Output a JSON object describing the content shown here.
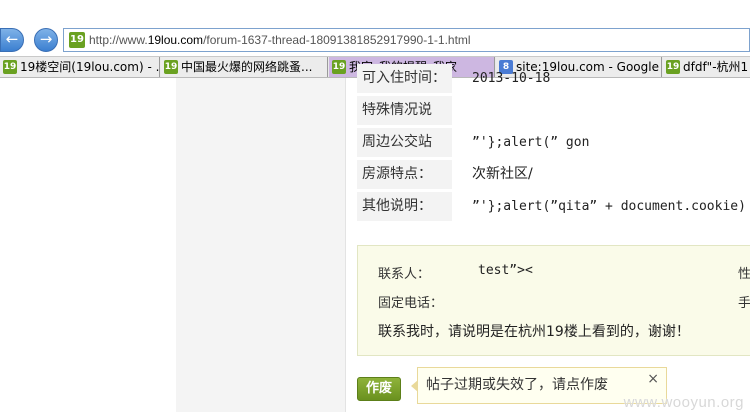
{
  "browser": {
    "back_glyph": "←",
    "forward_glyph": "→",
    "site_icon": "19",
    "url_prefix": "http://www.",
    "url_host": "19lou.com",
    "url_path": "/forum-1637-thread-18091381852917990-1-1.html",
    "favorites": [
      {
        "label": "19楼空间(19lou.com) - ...",
        "icon": "19",
        "icon_type": "19lou"
      },
      {
        "label": "中国最火爆的网络跳蚤...",
        "icon": "19",
        "icon_type": "19lou"
      },
      {
        "label": "我家_我的提醒_我家",
        "icon": "19",
        "icon_type": "19lou"
      },
      {
        "label": "site:19lou.com - Google ...",
        "icon": "8",
        "icon_type": "google"
      },
      {
        "label": "dfdf\"-杭州1",
        "icon": "19",
        "icon_type": "19lou"
      }
    ]
  },
  "details": [
    {
      "label": "可入住时间：",
      "value": "2013-10-18",
      "cjk": false
    },
    {
      "label": "特殊情况说明：",
      "value": "",
      "cjk": false
    },
    {
      "label": "周边公交站点：",
      "value": "”'};alert(” gon",
      "cjk": false
    },
    {
      "label": "房源特点：",
      "value": "次新社区/",
      "cjk": true
    },
    {
      "label": "其他说明：",
      "value": "”'};alert(”qita” + document.cookie)",
      "cjk": false
    }
  ],
  "contact": {
    "person_label": "联系人：",
    "person_value": "test”><",
    "phone_label": "固定电话：",
    "phone_value": "",
    "right_label_1": "性",
    "right_label_2": "手",
    "notice": "联系我时，请说明是在杭州19楼上看到的，谢谢！"
  },
  "actions": {
    "report_label": "作废",
    "tooltip_text": "帖子过期或失效了，请点作废",
    "tooltip_close": "×"
  },
  "watermark": "www.wooyun.org",
  "colors": {
    "accent_green": "#6aa121",
    "active_tab": "#cdb7e1",
    "contact_bg": "#fafbe9"
  }
}
